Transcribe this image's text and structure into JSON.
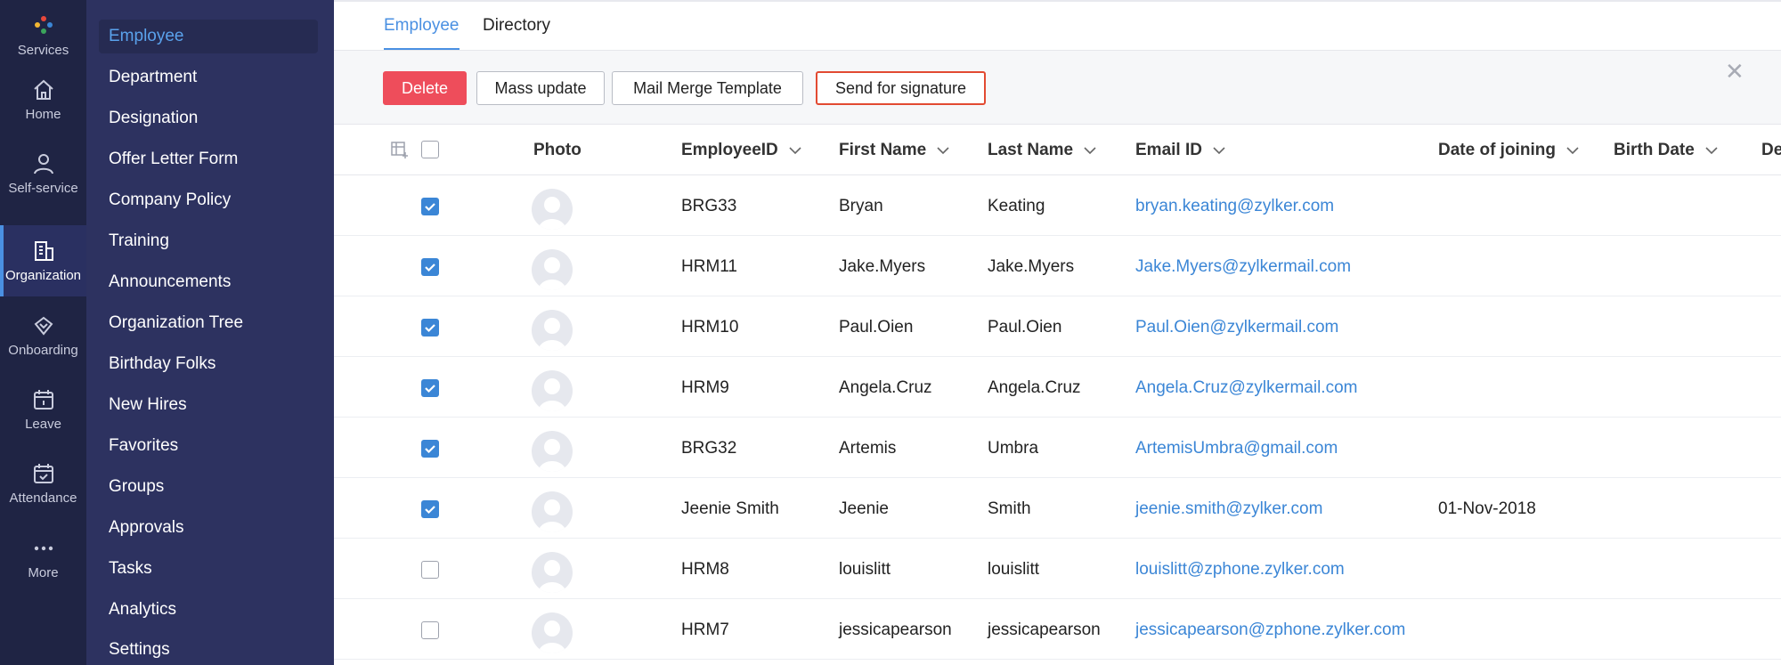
{
  "rail": [
    {
      "label": "Services",
      "icon": "services-icon"
    },
    {
      "label": "Home",
      "icon": "home-icon"
    },
    {
      "label": "Self-service",
      "icon": "user-icon"
    },
    {
      "label": "Organization",
      "icon": "building-icon",
      "active": true
    },
    {
      "label": "Onboarding",
      "icon": "handshake-icon"
    },
    {
      "label": "Leave",
      "icon": "calendar-icon"
    },
    {
      "label": "Attendance",
      "icon": "calendar-check-icon"
    },
    {
      "label": "More",
      "icon": "more-icon"
    }
  ],
  "menu": [
    "Employee",
    "Department",
    "Designation",
    "Offer Letter Form",
    "Company Policy",
    "Training",
    "Announcements",
    "Organization Tree",
    "Birthday Folks",
    "New Hires",
    "Favorites",
    "Groups",
    "Approvals",
    "Tasks",
    "Analytics",
    "Settings"
  ],
  "tabs": [
    "Employee",
    "Directory"
  ],
  "actions": {
    "delete": "Delete",
    "mass_update": "Mass update",
    "mail_merge": "Mail Merge Template",
    "send_signature": "Send for signature"
  },
  "columns": {
    "photo": "Photo",
    "employee_id": "EmployeeID",
    "first_name": "First Name",
    "last_name": "Last Name",
    "email": "Email ID",
    "doj": "Date of joining",
    "birth": "Birth Date",
    "partial": "De"
  },
  "rows": [
    {
      "checked": true,
      "id": "BRG33",
      "first": "Bryan",
      "last": "Keating",
      "email": "bryan.keating@zylker.com",
      "doj": ""
    },
    {
      "checked": true,
      "id": "HRM11",
      "first": "Jake.Myers",
      "last": "Jake.Myers",
      "email": "Jake.Myers@zylkermail.com",
      "doj": ""
    },
    {
      "checked": true,
      "id": "HRM10",
      "first": "Paul.Oien",
      "last": "Paul.Oien",
      "email": "Paul.Oien@zylkermail.com",
      "doj": ""
    },
    {
      "checked": true,
      "id": "HRM9",
      "first": "Angela.Cruz",
      "last": "Angela.Cruz",
      "email": "Angela.Cruz@zylkermail.com",
      "doj": ""
    },
    {
      "checked": true,
      "id": "BRG32",
      "first": "Artemis",
      "last": "Umbra",
      "email": "ArtemisUmbra@gmail.com",
      "doj": ""
    },
    {
      "checked": true,
      "id": "Jeenie Smith",
      "first": "Jeenie",
      "last": "Smith",
      "email": "jeenie.smith@zylker.com",
      "doj": "01-Nov-2018"
    },
    {
      "checked": false,
      "id": "HRM8",
      "first": "louislitt",
      "last": "louislitt",
      "email": "louislitt@zphone.zylker.com",
      "doj": ""
    },
    {
      "checked": false,
      "id": "HRM7",
      "first": "jessicapearson",
      "last": "jessicapearson",
      "email": "jessicapearson@zphone.zylker.com",
      "doj": ""
    }
  ],
  "colors": {
    "rail_bg": "#1f2444",
    "menu_bg": "#2d3260",
    "accent": "#4a90e2",
    "delete": "#ee4d5b",
    "signature_outline": "#e24a32"
  }
}
